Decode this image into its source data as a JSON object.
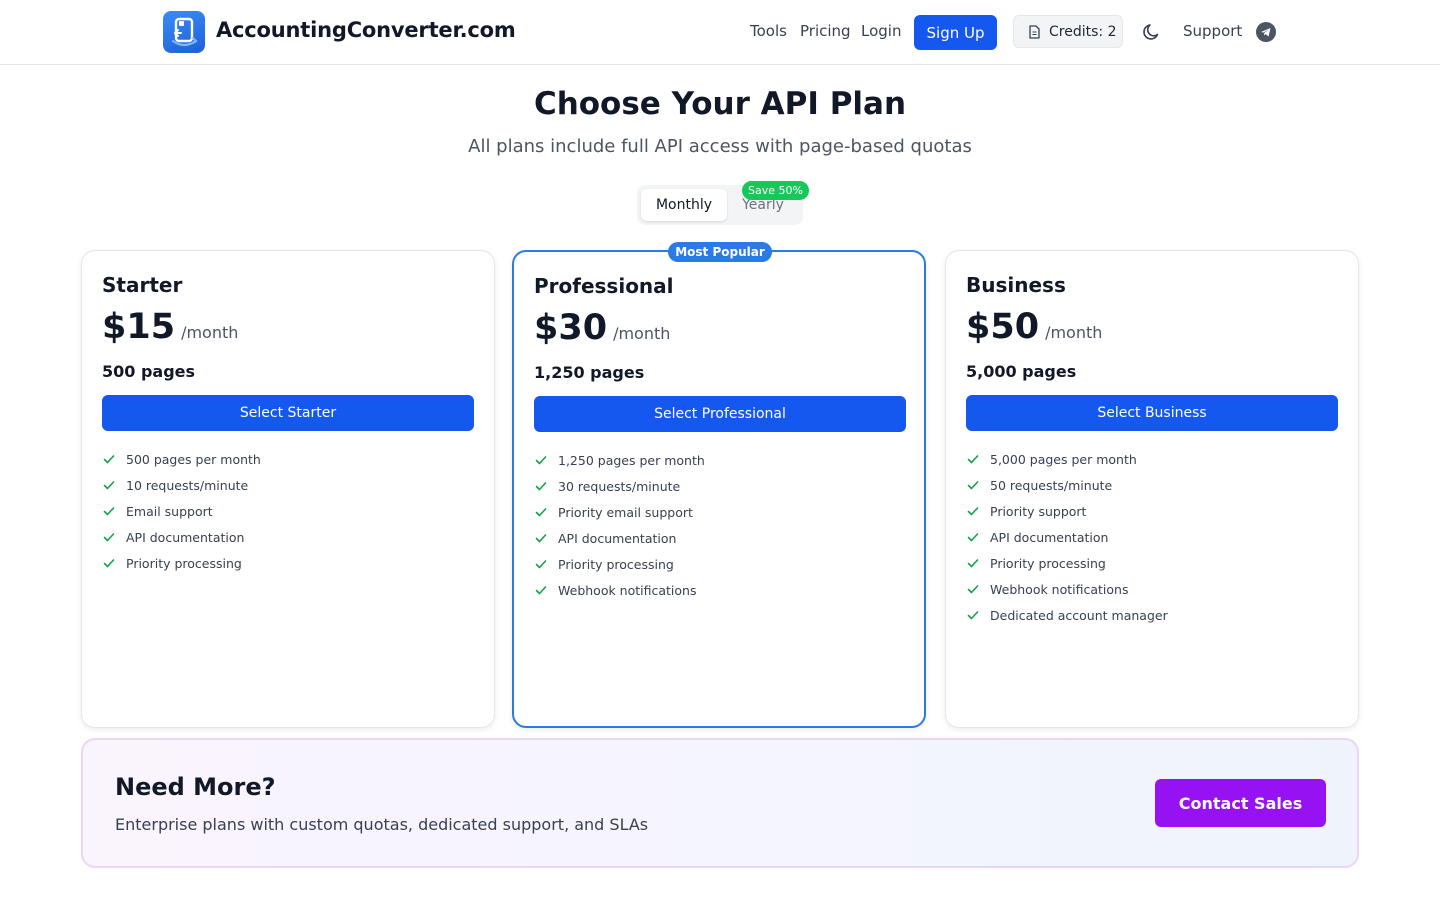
{
  "header": {
    "brand": "AccountingConverter.com",
    "nav": {
      "tools": "Tools",
      "pricing": "Pricing",
      "login": "Login",
      "signup": "Sign Up",
      "support": "Support"
    },
    "credits_label": "Credits: 2",
    "icons": [
      "logo-icon",
      "document-icon",
      "moon-icon",
      "telegram-icon"
    ]
  },
  "hero": {
    "title": "Choose Your API Plan",
    "subtitle": "All plans include full API access with page-based quotas"
  },
  "billing_toggle": {
    "monthly": "Monthly",
    "yearly": "Yearly",
    "save_badge": "Save 50%",
    "selected": "Monthly"
  },
  "plans": [
    {
      "name": "Starter",
      "price": "$15",
      "period": "/month",
      "pages": "500 pages",
      "button": "Select Starter",
      "features": [
        "500 pages per month",
        "10 requests/minute",
        "Email support",
        "API documentation",
        "Priority processing"
      ]
    },
    {
      "name": "Professional",
      "badge": "Most Popular",
      "price": "$30",
      "period": "/month",
      "pages": "1,250 pages",
      "button": "Select Professional",
      "features": [
        "1,250 pages per month",
        "30 requests/minute",
        "Priority email support",
        "API documentation",
        "Priority processing",
        "Webhook notifications"
      ]
    },
    {
      "name": "Business",
      "price": "$50",
      "period": "/month",
      "pages": "5,000 pages",
      "button": "Select Business",
      "features": [
        "5,000 pages per month",
        "50 requests/minute",
        "Priority support",
        "API documentation",
        "Priority processing",
        "Webhook notifications",
        "Dedicated account manager"
      ]
    }
  ],
  "enterprise": {
    "title": "Need More?",
    "text": "Enterprise plans with custom quotas, dedicated support, and SLAs",
    "button": "Contact Sales"
  },
  "colors": {
    "primary": "#1558f0",
    "featured_border": "#2b7ae6",
    "save_green": "#16c75a",
    "check_green": "#16a34a",
    "contact_purple": "#9612f3"
  }
}
